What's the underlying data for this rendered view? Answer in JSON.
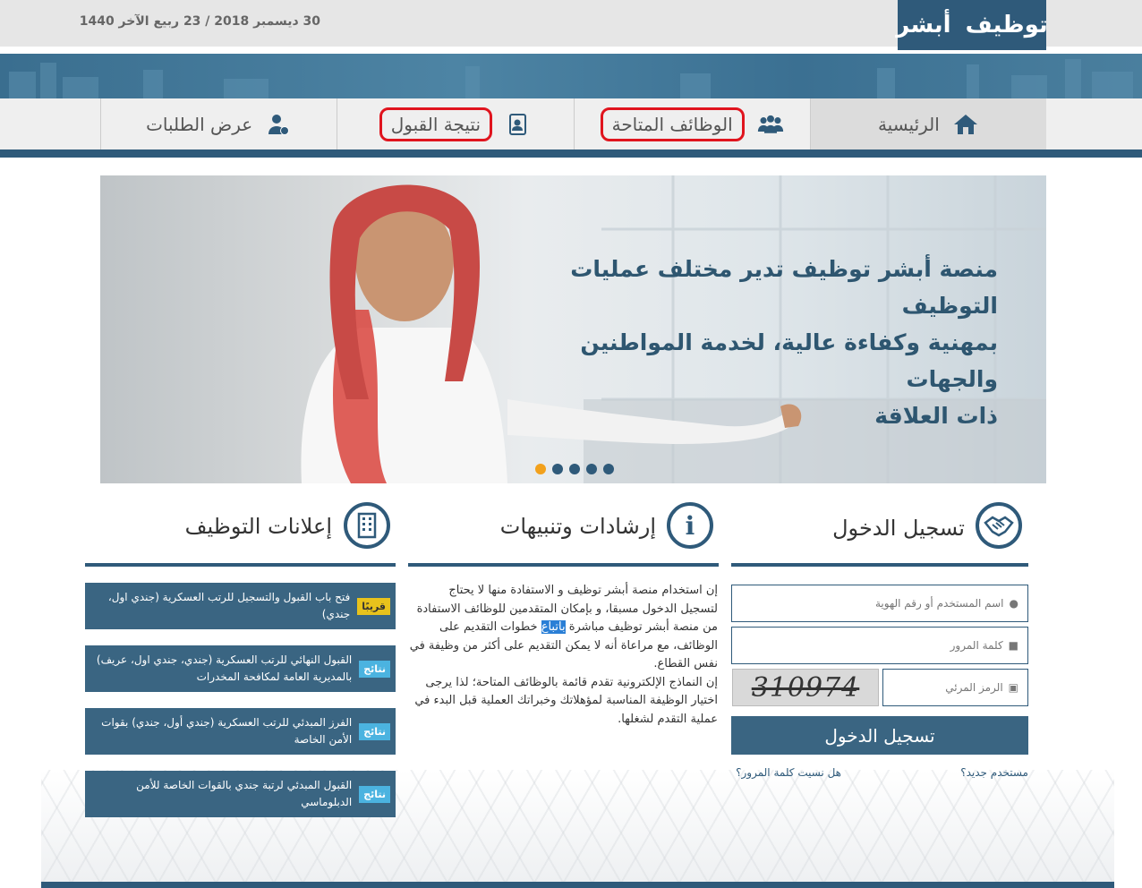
{
  "header": {
    "date": "30 ديسمبر 2018 / 23 ربيع الآخر 1440",
    "logo_left": "أبشر",
    "logo_right": "توظيف"
  },
  "nav": {
    "home": "الرئيسية",
    "jobs": "الوظائف المتاحة",
    "result": "نتيجة القبول",
    "requests": "عرض الطلبات"
  },
  "hero": {
    "line1": "منصة أبشر توظيف تدير مختلف عمليات التوظيف",
    "line2": "بمهنية وكفاءة عالية، لخدمة المواطنين والجهات",
    "line3": "ذات العلاقة"
  },
  "login": {
    "title": "تسجيل الدخول",
    "username_placeholder": "اسم المستخدم أو رقم الهوية",
    "password_placeholder": "كلمة المرور",
    "captcha_placeholder": "الرمز المرئي",
    "captcha_code": "310974",
    "submit": "تسجيل الدخول",
    "new_user": "مستخدم جديد؟",
    "forgot": "هل نسيت كلمة المرور؟"
  },
  "guidance": {
    "title": "إرشادات وتنبيهات",
    "p1_before": "إن استخدام منصة أبشر توظيف و الاستفادة منها لا يحتاج لتسجيل الدخول مسبقا، و بإمكان المتقدمين للوظائف الاستفادة من منصة أبشر توظيف مباشرة ",
    "p1_highlight": "باتباع",
    "p1_after": " خطوات التقديم على الوظائف، مع مراعاة أنه لا يمكن التقديم على أكثر من وظيفة في نفس القطاع.",
    "p2": "إن النماذج الإلكترونية تقدم قائمة بالوظائف المتاحة؛ لذا يرجى اختيار الوظيفة المناسبة لمؤهلاتك وخبراتك العملية قبل البدء في عملية التقدم لشغلها."
  },
  "ads": {
    "title": "إعلانات التوظيف",
    "items": [
      {
        "badge": "قريبًا",
        "text": "فتح باب القبول والتسجيل للرتب العسكرية (جندي اول، جندي)"
      },
      {
        "badge": "نتائج",
        "text": "القبول النهائي للرتب العسكرية (جندي، جندي اول، عريف) بالمديرية العامة لمكافحة المخدرات"
      },
      {
        "badge": "نتائج",
        "text": "الفرز المبدئي للرتب العسكرية (جندي أول، جندي) بقوات الأمن الخاصة"
      },
      {
        "badge": "نتائج",
        "text": "القبول المبدئي لرتبة جندي بالقوات الخاصة للأمن الدبلوماسي"
      }
    ]
  },
  "colors": {
    "primary": "#2f5a7a",
    "highlight_circle": "#e0141e",
    "badge_soon": "#e8c21c",
    "badge_results": "#4bb3e0",
    "slider_active": "#f2a11c"
  }
}
